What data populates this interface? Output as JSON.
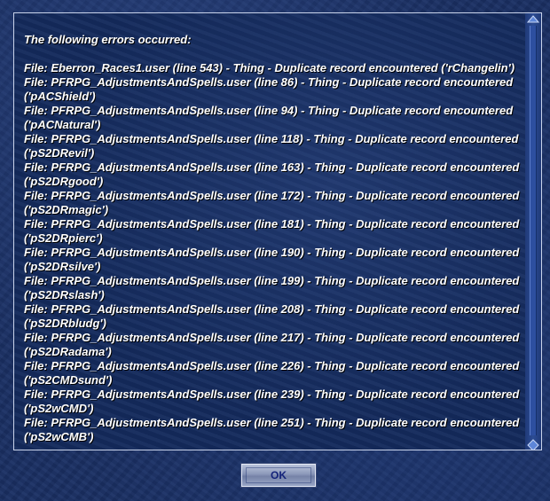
{
  "dialog": {
    "heading": "The following errors occurred:",
    "errors": [
      "File: Eberron_Races1.user (line 543) - Thing - Duplicate record encountered ('rChangelin')",
      "File: PFRPG_AdjustmentsAndSpells.user (line 86) - Thing - Duplicate record encountered ('pACShield')",
      "File: PFRPG_AdjustmentsAndSpells.user (line 94) - Thing - Duplicate record encountered ('pACNatural')",
      "File: PFRPG_AdjustmentsAndSpells.user (line 118) - Thing - Duplicate record encountered ('pS2DRevil')",
      "File: PFRPG_AdjustmentsAndSpells.user (line 163) - Thing - Duplicate record encountered ('pS2DRgood')",
      "File: PFRPG_AdjustmentsAndSpells.user (line 172) - Thing - Duplicate record encountered ('pS2DRmagic')",
      "File: PFRPG_AdjustmentsAndSpells.user (line 181) - Thing - Duplicate record encountered ('pS2DRpierc')",
      "File: PFRPG_AdjustmentsAndSpells.user (line 190) - Thing - Duplicate record encountered ('pS2DRsilve')",
      "File: PFRPG_AdjustmentsAndSpells.user (line 199) - Thing - Duplicate record encountered ('pS2DRslash')",
      "File: PFRPG_AdjustmentsAndSpells.user (line 208) - Thing - Duplicate record encountered ('pS2DRbludg')",
      "File: PFRPG_AdjustmentsAndSpells.user (line 217) - Thing - Duplicate record encountered ('pS2DRadama')",
      "File: PFRPG_AdjustmentsAndSpells.user (line 226) - Thing - Duplicate record encountered ('pS2CMDsund')",
      "File: PFRPG_AdjustmentsAndSpells.user (line 239) - Thing - Duplicate record encountered ('pS2wCMD')",
      "File: PFRPG_AdjustmentsAndSpells.user (line 251) - Thing - Duplicate record encountered ('pS2wCMB')"
    ],
    "ok_label": "OK"
  },
  "scrollbar": {
    "up_icon": "scroll-up-arrow-icon",
    "down_icon": "scroll-down-arrow-icon"
  },
  "colors": {
    "background": "#1a2f63",
    "text": "#ffffff",
    "button_text": "#14237a"
  }
}
